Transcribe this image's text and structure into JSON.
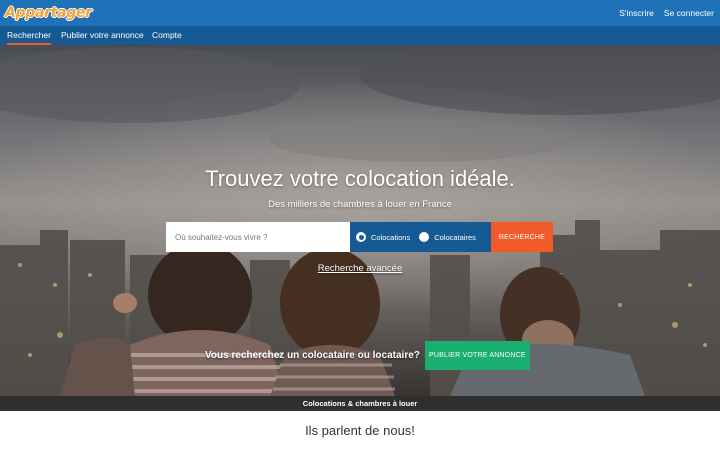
{
  "header": {
    "logo_text": "Appartager",
    "links": [
      "S'inscrire",
      "Se connecter"
    ]
  },
  "nav": {
    "items": [
      {
        "label": "Rechercher",
        "active": true
      },
      {
        "label": "Publier votre annonce",
        "active": false
      },
      {
        "label": "Compte",
        "active": false
      }
    ]
  },
  "hero": {
    "title": "Trouvez votre colocation idéale.",
    "subtitle": "Des milliers de chambres à louer en France",
    "search": {
      "placeholder": "Où souhaitez-vous vivre ?",
      "value": "",
      "options": [
        {
          "label": "Colocations",
          "checked": true
        },
        {
          "label": "Colocataires",
          "checked": false
        }
      ],
      "button": "RECHERCHE"
    },
    "advanced_link": "Recherche avancée",
    "cta_text": "Vous recherchez un colocataire ou locataire?",
    "cta_button": "PUBLIER VOTRE ANNONCE"
  },
  "strip": {
    "text": "Colocations & chambres à louer"
  },
  "testimonials": {
    "title": "Ils parlent de nous!"
  },
  "colors": {
    "topbar": "#1f72b8",
    "navbar": "#165a95",
    "accent": "#f15a29",
    "cta": "#1aae6f",
    "logo": "#f6a234"
  }
}
